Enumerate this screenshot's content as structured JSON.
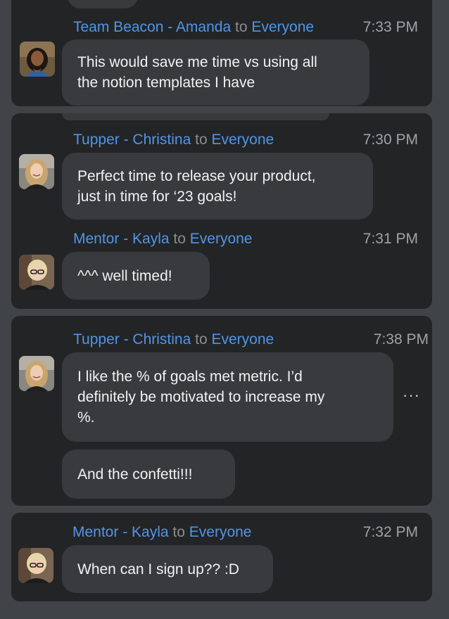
{
  "messages": [
    {
      "sender": "Team Beacon - Amanda",
      "to": "to",
      "recipient": "Everyone",
      "time": "7:33 PM",
      "lines": [
        "This would save me time vs using all",
        "the notion templates I have"
      ]
    },
    {
      "sender": "Tupper - Christina",
      "to": "to",
      "recipient": "Everyone",
      "time": "7:30 PM",
      "lines": [
        "Perfect time to release your product,",
        "just in time for ‘23 goals!"
      ]
    },
    {
      "sender": "Mentor - Kayla",
      "to": "to",
      "recipient": "Everyone",
      "time": "7:31 PM",
      "lines": [
        "^^^ well timed!"
      ]
    },
    {
      "sender": "Tupper - Christina",
      "to": "to",
      "recipient": "Everyone",
      "time": "7:38 PM",
      "lines": [
        "I like the % of goals met metric. I’d",
        "definitely be motivated to increase my",
        "%."
      ],
      "followup": "And the confetti!!!",
      "more_icon": "···"
    },
    {
      "sender": "Mentor - Kayla",
      "to": "to",
      "recipient": "Everyone",
      "time": "7:32 PM",
      "lines": [
        "When can I sign up?? :D"
      ]
    }
  ],
  "colors": {
    "background": "#404347",
    "card": "#232426",
    "bubble": "#393a3d",
    "name": "#4f96e8",
    "time": "#a0a2a6",
    "text": "#f2f2f2"
  }
}
